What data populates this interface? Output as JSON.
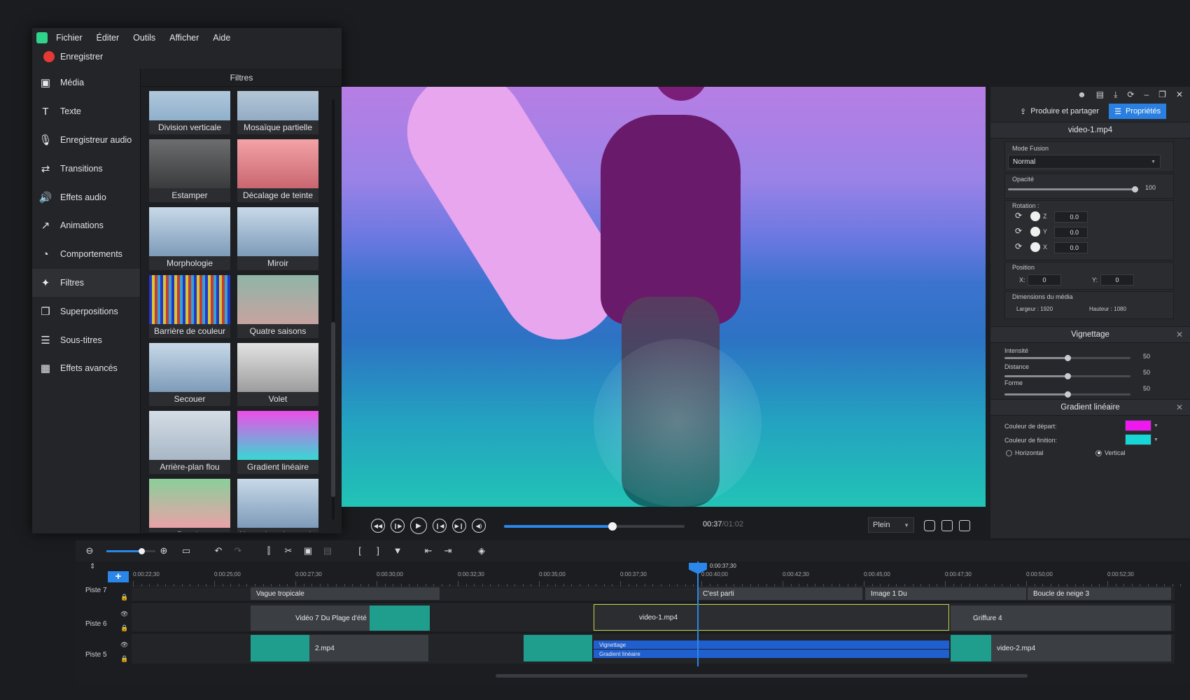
{
  "menu": [
    "Fichier",
    "Éditer",
    "Outils",
    "Afficher",
    "Aide"
  ],
  "record_label": "Enregistrer",
  "sidebar": {
    "items": [
      {
        "label": "Média",
        "icon": "media-icon",
        "glyph": "▣"
      },
      {
        "label": "Texte",
        "icon": "text-icon",
        "glyph": "T"
      },
      {
        "label": "Enregistreur audio",
        "icon": "microphone-icon",
        "glyph": "🎙"
      },
      {
        "label": "Transitions",
        "icon": "transitions-icon",
        "glyph": "⇄"
      },
      {
        "label": "Effets audio",
        "icon": "speaker-icon",
        "glyph": "🔊"
      },
      {
        "label": "Animations",
        "icon": "arrow-icon",
        "glyph": "↗"
      },
      {
        "label": "Comportements",
        "icon": "behavior-icon",
        "glyph": "◔"
      },
      {
        "label": "Filtres",
        "icon": "magic-wand-icon",
        "glyph": "✦",
        "active": true
      },
      {
        "label": "Superpositions",
        "icon": "overlay-icon",
        "glyph": "❐"
      },
      {
        "label": "Sous-titres",
        "icon": "subtitles-icon",
        "glyph": "☰"
      },
      {
        "label": "Effets avancés",
        "icon": "advanced-effects-icon",
        "glyph": "▦"
      }
    ]
  },
  "filters": {
    "title": "Filtres",
    "items": [
      {
        "label": "Division verticale",
        "colors": [
          "#c6d7e6",
          "#8fb0cc"
        ]
      },
      {
        "label": "Mosaïque partielle",
        "colors": [
          "#c9d8e4",
          "#93acc4"
        ]
      },
      {
        "label": "Estamper",
        "colors": [
          "#6b6d6f",
          "#3a3b3d"
        ]
      },
      {
        "label": "Décalage de teinte",
        "colors": [
          "#f3a3a7",
          "#c9666f"
        ]
      },
      {
        "label": "Morphologie",
        "colors": [
          "#c8d9e8",
          "#7d9bb9"
        ]
      },
      {
        "label": "Miroir",
        "colors": [
          "#c8d9e8",
          "#7d9bb9"
        ]
      },
      {
        "label": "Barrière de couleur",
        "colors": [
          "#3c3fd0",
          "#d8d23a"
        ]
      },
      {
        "label": "Quatre saisons",
        "colors": [
          "#8fb5a8",
          "#c7a3a0"
        ]
      },
      {
        "label": "Secouer",
        "colors": [
          "#c8d9e8",
          "#7d9bb9"
        ]
      },
      {
        "label": "Volet",
        "colors": [
          "#e3e3e3",
          "#9c9c9c"
        ]
      },
      {
        "label": "Arrière-plan flou",
        "colors": [
          "#d4dde6",
          "#a8b7c6"
        ]
      },
      {
        "label": "Gradient linéaire",
        "colors": [
          "#ee4ee8",
          "#38d8d4"
        ]
      },
      {
        "label": "Puzzle",
        "colors": [
          "#8bcf9a",
          "#e9a2a8"
        ]
      },
      {
        "label": "Aberration chromati...",
        "colors": [
          "#c8d9e8",
          "#7d9bb9"
        ]
      }
    ]
  },
  "transport": {
    "progress": 0.6,
    "current_time": "00:37",
    "total_time": "/01:02",
    "zoom_mode": "Plein"
  },
  "properties": {
    "tab_produce": "Produire et partager",
    "tab_properties": "Propriétés",
    "clip_name": "video-1.mp4",
    "blend_label": "Mode Fusion",
    "blend_value": "Normal",
    "opacity_label": "Opacité",
    "opacity_value": "100",
    "opacity": 1.0,
    "rotation_label": "Rotation :",
    "rotation": [
      {
        "axis": "Z",
        "value": "0.0"
      },
      {
        "axis": "Y",
        "value": "0.0"
      },
      {
        "axis": "X",
        "value": "0.0"
      }
    ],
    "position_label": "Position",
    "pos_x_label": "X:",
    "pos_x": "0",
    "pos_y_label": "Y:",
    "pos_y": "0",
    "media_dim_label": "Dimensions du média",
    "width_label": "Largeur : 1920",
    "height_label": "Hauteur : 1080",
    "vignette_title": "Vignettage",
    "vignette": [
      {
        "label": "Intensité",
        "value": "50",
        "level": 0.5
      },
      {
        "label": "Distance",
        "value": "50",
        "level": 0.5
      },
      {
        "label": "Forme",
        "value": "50",
        "level": 0.5
      }
    ],
    "gradient_title": "Gradient linéaire",
    "start_color_label": "Couleur de départ:",
    "start_color": "#f018f0",
    "end_color_label": "Couleur de finition:",
    "end_color": "#16d6d6",
    "horizontal_label": "Horizontal",
    "vertical_label": "Vertical"
  },
  "timeline": {
    "ticks": [
      "0:00:22;30",
      "0:00:25;00",
      "0:00:27;30",
      "0:00:30;00",
      "0:00:32;30",
      "0:00:35;00",
      "0:00:37;30",
      "0:00:40;00",
      "0:00:42;30",
      "0:00:45;00",
      "0:00:47;30",
      "0:00:50;00",
      "0:00:52;30"
    ],
    "playhead_time": "0:00:37;30",
    "tracks": {
      "piste7": "Piste 7",
      "piste6": "Piste 6",
      "piste5": "Piste 5"
    },
    "clips": {
      "vague": "Vague tropicale",
      "cestparti": "C'est parti",
      "image": "Image 1 Du",
      "boucle": "Boucle de neige 3",
      "video7": "Vidéo 7 Du Plage d'été",
      "video1": "video-1.mp4",
      "griffure": "Griffure 4",
      "video2a": "2.mp4",
      "video2b": "video-2.mp4",
      "fx_vignette": "Vignettage",
      "fx_gradient": "Gradient linéaire"
    }
  }
}
